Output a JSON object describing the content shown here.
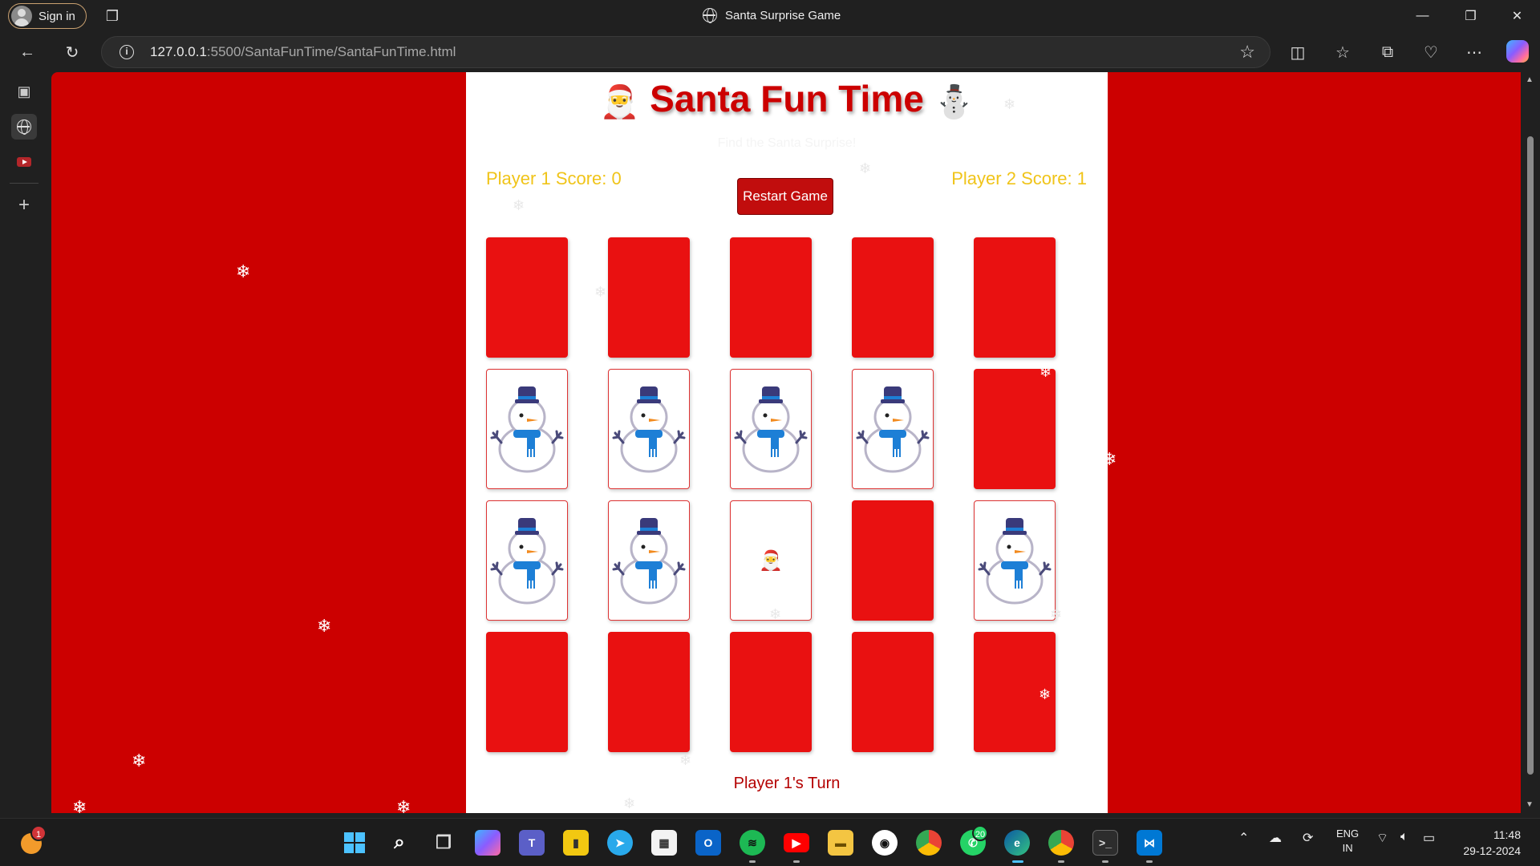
{
  "browser": {
    "signin_label": "Sign in",
    "tab_title": "Santa Surprise Game",
    "url_host": "127.0.0.1",
    "url_rest": ":5500/SantaFunTime/SantaFunTime.html"
  },
  "game": {
    "title": "Santa Fun Time",
    "title_left_emoji": "🎅",
    "title_right_emoji": "⛄",
    "subtitle": "Find the Santa Surprise!",
    "player1_score": "Player 1 Score: 0",
    "player2_score": "Player 2 Score: 1",
    "restart_label": "Restart Game",
    "turn_text": "Player 1's Turn",
    "cards": [
      "back",
      "back",
      "back",
      "back",
      "back",
      "snowman",
      "snowman",
      "snowman",
      "snowman",
      "back",
      "snowman",
      "snowman",
      "santa",
      "back",
      "snowman",
      "back",
      "back",
      "back",
      "back",
      "back"
    ],
    "santa_emoji": "🎅"
  },
  "taskbar": {
    "lang_line1": "ENG",
    "lang_line2": "IN",
    "time": "11:48",
    "date": "29-12-2024",
    "whatsapp_badge": "20",
    "notif_badge": "1"
  },
  "colors": {
    "page_bg": "#cc0000",
    "card_back": "#e91111",
    "score_text": "#f0c419",
    "title_text": "#cc0000"
  }
}
